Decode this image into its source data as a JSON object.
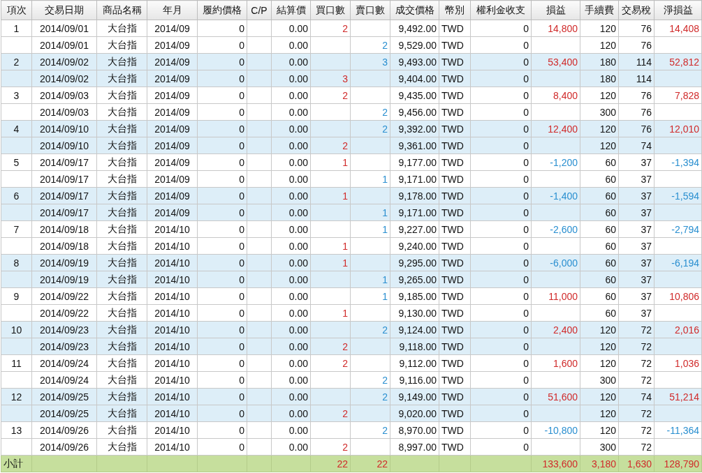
{
  "table": {
    "columns": [
      "項次",
      "交易日期",
      "商品名稱",
      "年月",
      "履約價格",
      "C/P",
      "結算價",
      "買口數",
      "賣口數",
      "成交價格",
      "幣別",
      "權利金收支",
      "損益",
      "手續費",
      "交易稅",
      "淨損益"
    ],
    "rows": [
      {
        "shaded": false,
        "loss": false,
        "no": "1",
        "date": "2014/09/01",
        "product": "大台指",
        "month": "2014/09",
        "strike": "0",
        "settle": "0.00",
        "buy": "2",
        "price": "9,492.00",
        "currency": "TWD",
        "premium": "0",
        "pnl": "14,800",
        "fee": "120",
        "tax": "76",
        "net": "14,408"
      },
      {
        "shaded": false,
        "date": "2014/09/01",
        "product": "大台指",
        "month": "2014/09",
        "strike": "0",
        "settle": "0.00",
        "sell": "2",
        "price": "9,529.00",
        "currency": "TWD",
        "premium": "0",
        "fee": "120",
        "tax": "76"
      },
      {
        "shaded": true,
        "loss": false,
        "no": "2",
        "date": "2014/09/02",
        "product": "大台指",
        "month": "2014/09",
        "strike": "0",
        "settle": "0.00",
        "sell": "3",
        "price": "9,493.00",
        "currency": "TWD",
        "premium": "0",
        "pnl": "53,400",
        "fee": "180",
        "tax": "114",
        "net": "52,812"
      },
      {
        "shaded": true,
        "date": "2014/09/02",
        "product": "大台指",
        "month": "2014/09",
        "strike": "0",
        "settle": "0.00",
        "buy": "3",
        "price": "9,404.00",
        "currency": "TWD",
        "premium": "0",
        "fee": "180",
        "tax": "114"
      },
      {
        "shaded": false,
        "loss": false,
        "no": "3",
        "date": "2014/09/03",
        "product": "大台指",
        "month": "2014/09",
        "strike": "0",
        "settle": "0.00",
        "buy": "2",
        "price": "9,435.00",
        "currency": "TWD",
        "premium": "0",
        "pnl": "8,400",
        "fee": "120",
        "tax": "76",
        "net": "7,828"
      },
      {
        "shaded": false,
        "date": "2014/09/03",
        "product": "大台指",
        "month": "2014/09",
        "strike": "0",
        "settle": "0.00",
        "sell": "2",
        "price": "9,456.00",
        "currency": "TWD",
        "premium": "0",
        "fee": "300",
        "tax": "76"
      },
      {
        "shaded": true,
        "loss": false,
        "no": "4",
        "date": "2014/09/10",
        "product": "大台指",
        "month": "2014/09",
        "strike": "0",
        "settle": "0.00",
        "sell": "2",
        "price": "9,392.00",
        "currency": "TWD",
        "premium": "0",
        "pnl": "12,400",
        "fee": "120",
        "tax": "76",
        "net": "12,010"
      },
      {
        "shaded": true,
        "date": "2014/09/10",
        "product": "大台指",
        "month": "2014/09",
        "strike": "0",
        "settle": "0.00",
        "buy": "2",
        "price": "9,361.00",
        "currency": "TWD",
        "premium": "0",
        "fee": "120",
        "tax": "74"
      },
      {
        "shaded": false,
        "loss": true,
        "no": "5",
        "date": "2014/09/17",
        "product": "大台指",
        "month": "2014/09",
        "strike": "0",
        "settle": "0.00",
        "buy": "1",
        "price": "9,177.00",
        "currency": "TWD",
        "premium": "0",
        "pnl": "-1,200",
        "fee": "60",
        "tax": "37",
        "net": "-1,394"
      },
      {
        "shaded": false,
        "date": "2014/09/17",
        "product": "大台指",
        "month": "2014/09",
        "strike": "0",
        "settle": "0.00",
        "sell": "1",
        "price": "9,171.00",
        "currency": "TWD",
        "premium": "0",
        "fee": "60",
        "tax": "37"
      },
      {
        "shaded": true,
        "loss": true,
        "no": "6",
        "date": "2014/09/17",
        "product": "大台指",
        "month": "2014/09",
        "strike": "0",
        "settle": "0.00",
        "buy": "1",
        "price": "9,178.00",
        "currency": "TWD",
        "premium": "0",
        "pnl": "-1,400",
        "fee": "60",
        "tax": "37",
        "net": "-1,594"
      },
      {
        "shaded": true,
        "date": "2014/09/17",
        "product": "大台指",
        "month": "2014/09",
        "strike": "0",
        "settle": "0.00",
        "sell": "1",
        "price": "9,171.00",
        "currency": "TWD",
        "premium": "0",
        "fee": "60",
        "tax": "37"
      },
      {
        "shaded": false,
        "loss": true,
        "no": "7",
        "date": "2014/09/18",
        "product": "大台指",
        "month": "2014/10",
        "strike": "0",
        "settle": "0.00",
        "sell": "1",
        "price": "9,227.00",
        "currency": "TWD",
        "premium": "0",
        "pnl": "-2,600",
        "fee": "60",
        "tax": "37",
        "net": "-2,794"
      },
      {
        "shaded": false,
        "date": "2014/09/18",
        "product": "大台指",
        "month": "2014/10",
        "strike": "0",
        "settle": "0.00",
        "buy": "1",
        "price": "9,240.00",
        "currency": "TWD",
        "premium": "0",
        "fee": "60",
        "tax": "37"
      },
      {
        "shaded": true,
        "loss": true,
        "no": "8",
        "date": "2014/09/19",
        "product": "大台指",
        "month": "2014/10",
        "strike": "0",
        "settle": "0.00",
        "buy": "1",
        "price": "9,295.00",
        "currency": "TWD",
        "premium": "0",
        "pnl": "-6,000",
        "fee": "60",
        "tax": "37",
        "net": "-6,194"
      },
      {
        "shaded": true,
        "date": "2014/09/19",
        "product": "大台指",
        "month": "2014/10",
        "strike": "0",
        "settle": "0.00",
        "sell": "1",
        "price": "9,265.00",
        "currency": "TWD",
        "premium": "0",
        "fee": "60",
        "tax": "37"
      },
      {
        "shaded": false,
        "loss": false,
        "no": "9",
        "date": "2014/09/22",
        "product": "大台指",
        "month": "2014/10",
        "strike": "0",
        "settle": "0.00",
        "sell": "1",
        "price": "9,185.00",
        "currency": "TWD",
        "premium": "0",
        "pnl": "11,000",
        "fee": "60",
        "tax": "37",
        "net": "10,806"
      },
      {
        "shaded": false,
        "date": "2014/09/22",
        "product": "大台指",
        "month": "2014/10",
        "strike": "0",
        "settle": "0.00",
        "buy": "1",
        "price": "9,130.00",
        "currency": "TWD",
        "premium": "0",
        "fee": "60",
        "tax": "37"
      },
      {
        "shaded": true,
        "loss": false,
        "no": "10",
        "date": "2014/09/23",
        "product": "大台指",
        "month": "2014/10",
        "strike": "0",
        "settle": "0.00",
        "sell": "2",
        "price": "9,124.00",
        "currency": "TWD",
        "premium": "0",
        "pnl": "2,400",
        "fee": "120",
        "tax": "72",
        "net": "2,016"
      },
      {
        "shaded": true,
        "date": "2014/09/23",
        "product": "大台指",
        "month": "2014/10",
        "strike": "0",
        "settle": "0.00",
        "buy": "2",
        "price": "9,118.00",
        "currency": "TWD",
        "premium": "0",
        "fee": "120",
        "tax": "72"
      },
      {
        "shaded": false,
        "loss": false,
        "no": "11",
        "date": "2014/09/24",
        "product": "大台指",
        "month": "2014/10",
        "strike": "0",
        "settle": "0.00",
        "buy": "2",
        "price": "9,112.00",
        "currency": "TWD",
        "premium": "0",
        "pnl": "1,600",
        "fee": "120",
        "tax": "72",
        "net": "1,036"
      },
      {
        "shaded": false,
        "date": "2014/09/24",
        "product": "大台指",
        "month": "2014/10",
        "strike": "0",
        "settle": "0.00",
        "sell": "2",
        "price": "9,116.00",
        "currency": "TWD",
        "premium": "0",
        "fee": "300",
        "tax": "72"
      },
      {
        "shaded": true,
        "loss": false,
        "no": "12",
        "date": "2014/09/25",
        "product": "大台指",
        "month": "2014/10",
        "strike": "0",
        "settle": "0.00",
        "sell": "2",
        "price": "9,149.00",
        "currency": "TWD",
        "premium": "0",
        "pnl": "51,600",
        "fee": "120",
        "tax": "74",
        "net": "51,214"
      },
      {
        "shaded": true,
        "date": "2014/09/25",
        "product": "大台指",
        "month": "2014/10",
        "strike": "0",
        "settle": "0.00",
        "buy": "2",
        "price": "9,020.00",
        "currency": "TWD",
        "premium": "0",
        "fee": "120",
        "tax": "72"
      },
      {
        "shaded": false,
        "loss": true,
        "no": "13",
        "date": "2014/09/26",
        "product": "大台指",
        "month": "2014/10",
        "strike": "0",
        "settle": "0.00",
        "sell": "2",
        "price": "8,970.00",
        "currency": "TWD",
        "premium": "0",
        "pnl": "-10,800",
        "fee": "120",
        "tax": "72",
        "net": "-11,364"
      },
      {
        "shaded": false,
        "date": "2014/09/26",
        "product": "大台指",
        "month": "2014/10",
        "strike": "0",
        "settle": "0.00",
        "buy": "2",
        "price": "8,997.00",
        "currency": "TWD",
        "premium": "0",
        "fee": "300",
        "tax": "72"
      }
    ],
    "subtotal": {
      "loss": false,
      "no": "小計",
      "buy": "22",
      "sell": "22",
      "pnl": "133,600",
      "fee": "3,180",
      "tax": "1,630",
      "net": "128,790"
    }
  }
}
